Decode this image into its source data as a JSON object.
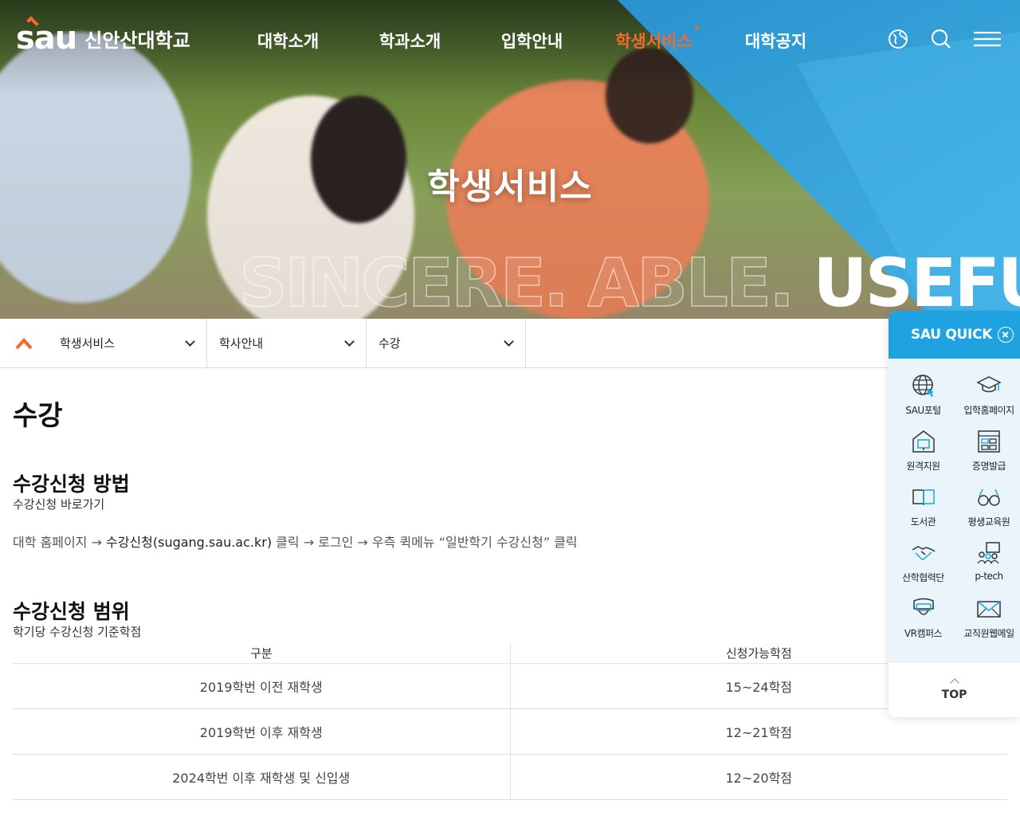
{
  "header": {
    "logo_mark": "sau",
    "logo_text": "신안산대학교",
    "nav": [
      "대학소개",
      "학과소개",
      "입학안내",
      "학생서비스",
      "대학공지"
    ],
    "active_nav": "학생서비스",
    "icons": [
      "globe-icon",
      "search-icon",
      "menu-icon"
    ]
  },
  "hero": {
    "title": "학생서비스",
    "slogan_ghost": "SINCERE. ABLE.",
    "slogan_solid": "USEFUL"
  },
  "breadcrumb": {
    "home_icon": "home-icon",
    "items": [
      "학생서비스",
      "학사안내",
      "수강"
    ]
  },
  "content": {
    "page_title": "수강",
    "section1": {
      "title": "수강신청 방법",
      "subtitle": "수강신청 바로가기",
      "step1": "대학 홈페이지 → ",
      "step2": "수강신청(sugang.sau.ac.kr)",
      "step3": " 클릭 → 로그인 → 우측 퀵메뉴 “일반학기 수강신청” 클릭"
    },
    "section2": {
      "title": "수강신청 범위",
      "subtitle": "학기당 수강신청 기준학점",
      "table": {
        "headers": [
          "구분",
          "신청가능학점"
        ],
        "rows": [
          [
            "2019학번 이전 재학생",
            "15~24학점"
          ],
          [
            "2019학번 이후 재학생",
            "12~21학점"
          ],
          [
            "2024학번 이후 재학생 및 신입생",
            "12~20학점"
          ]
        ]
      }
    }
  },
  "quick": {
    "title": "SAU QUICK",
    "items": [
      {
        "label": "SAU포털",
        "icon": "portal-icon"
      },
      {
        "label": "입학홈페이지",
        "icon": "graduation-cap-icon"
      },
      {
        "label": "원격지원",
        "icon": "remote-support-icon"
      },
      {
        "label": "증명발급",
        "icon": "certificate-icon"
      },
      {
        "label": "도서관",
        "icon": "book-icon"
      },
      {
        "label": "평생교육원",
        "icon": "glasses-icon"
      },
      {
        "label": "산학협력단",
        "icon": "handshake-icon"
      },
      {
        "label": "p-tech",
        "icon": "p-tech-icon"
      },
      {
        "label": "VR캠퍼스",
        "icon": "vr-headset-icon"
      },
      {
        "label": "교직원웹메일",
        "icon": "mail-icon"
      }
    ],
    "top_label": "TOP"
  },
  "colors": {
    "accent": "#f26a2e",
    "quick_blue": "#1ea3e0",
    "quick_bg": "#e9f4fb"
  }
}
